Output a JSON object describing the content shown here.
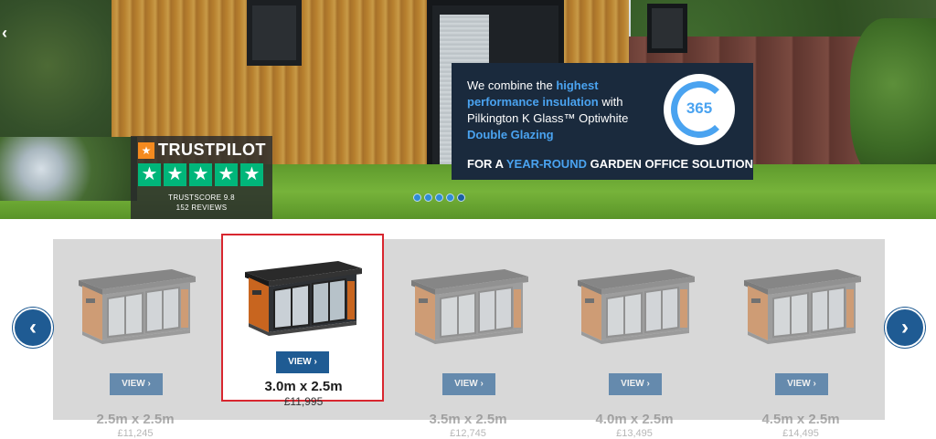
{
  "hero": {
    "trustpilot": {
      "brand": "TRUSTPILOT",
      "stars": 5,
      "score": "TRUSTSCORE 9.8",
      "reviews": "152 REVIEWS",
      "star_color": "#00b67a"
    },
    "promo": {
      "text_prefix": "We combine the ",
      "highlight_1": "highest performance insulation",
      "text_mid": " with Pilkington K Glass™ Optiwhite ",
      "highlight_2": "Double Glazing",
      "badge": "365",
      "sub_prefix": "FOR A ",
      "sub_highlight": "YEAR-ROUND",
      "sub_suffix": " GARDEN OFFICE SOLUTION",
      "accent": "#4aa3f0"
    },
    "slides_total": 5,
    "active_slide": 5
  },
  "carousel": {
    "prev_label": "‹",
    "next_label": "›",
    "items": [
      {
        "size": "2.5m x 2.5m",
        "price": "£11,245",
        "view": "VIEW",
        "selected": false
      },
      {
        "size": "3.0m x 2.5m",
        "price": "£11,995",
        "view": "VIEW",
        "selected": true
      },
      {
        "size": "3.5m x 2.5m",
        "price": "£12,745",
        "view": "VIEW",
        "selected": false
      },
      {
        "size": "4.0m x 2.5m",
        "price": "£13,495",
        "view": "VIEW",
        "selected": false
      },
      {
        "size": "4.5m x 2.5m",
        "price": "£14,495",
        "view": "VIEW",
        "selected": false
      }
    ],
    "button_color": "#1f5b93",
    "selected_border": "#d8262f"
  }
}
